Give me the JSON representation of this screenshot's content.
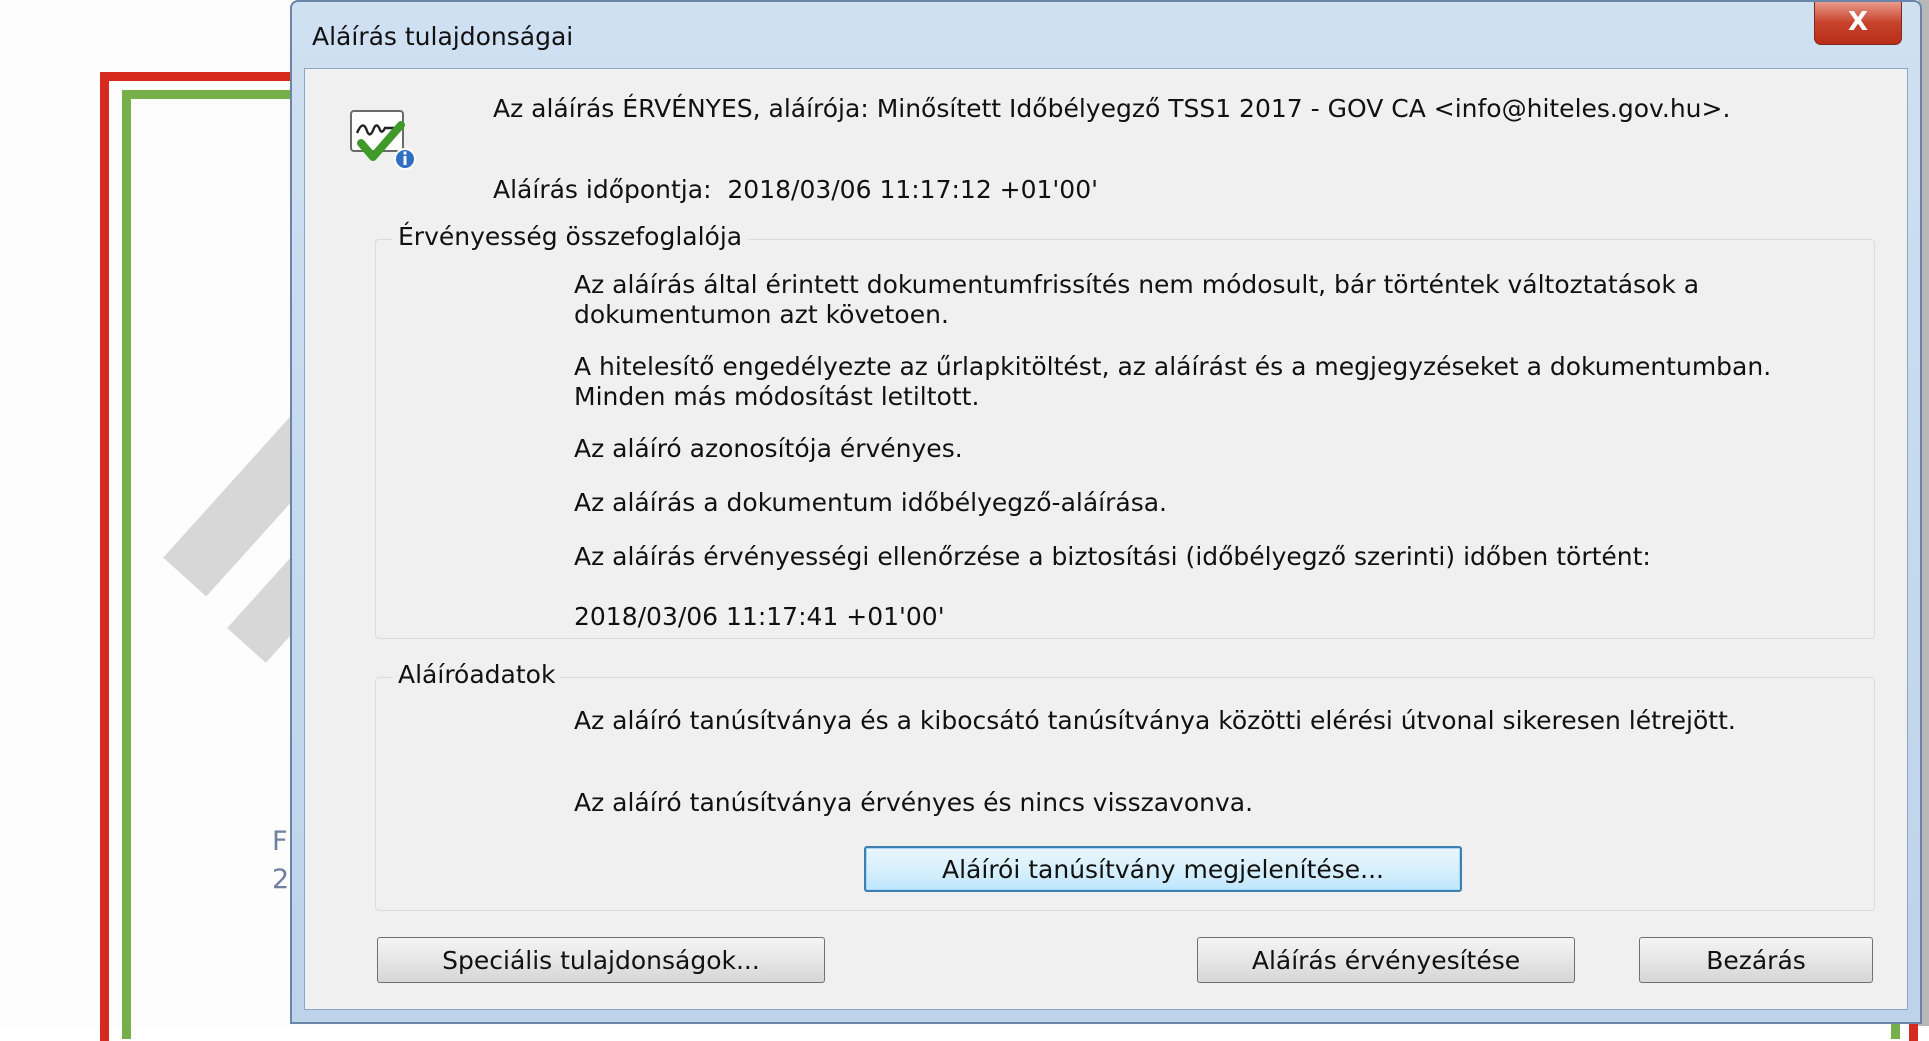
{
  "background": {
    "fragment_1": "F",
    "fragment_2": "2"
  },
  "dialog": {
    "title": "Aláírás tulajdonságai",
    "close_label": "X",
    "status_line": "Az aláírás ÉRVÉNYES, aláírója: Minősített Időbélyegző TSS1 2017 - GOV CA <info@hiteles.gov.hu>.",
    "signing_time_label": "Aláírás időpontja:",
    "signing_time_value": "2018/03/06 11:17:12 +01'00'",
    "validity_summary": {
      "legend": "Érvényesség összefoglalója",
      "lines": [
        "Az aláírás által érintett dokumentumfrissítés nem módosult, bár történtek változtatások a dokumentumon azt követoen.",
        "A hitelesítő engedélyezte az űrlapkitöltést, az aláírást és a megjegyzéseket a dokumentumban. Minden más módosítást letiltott.",
        "Az aláíró azonosítója érvényes.",
        "Az aláírás a dokumentum időbélyegző-aláírása.",
        "Az aláírás érvényességi ellenőrzése a biztosítási (időbélyegző szerinti) időben történt:"
      ],
      "check_time": "2018/03/06 11:17:41 +01'00'"
    },
    "signer_info": {
      "legend": "Aláíróadatok",
      "lines": [
        "Az aláíró tanúsítványa és a kibocsátó tanúsítványa közötti elérési útvonal sikeresen létrejött.",
        "Az aláíró tanúsítványa érvényes és nincs visszavonva."
      ],
      "show_cert_button": "Aláírói tanúsítvány megjelenítése..."
    },
    "buttons": {
      "advanced": "Speciális tulajdonságok...",
      "validate": "Aláírás érvényesítése",
      "close": "Bezárás"
    }
  },
  "colors": {
    "titlebar": "#c4d8ee",
    "close_button": "#c7422c",
    "dialog_body": "#f0f0f0",
    "focused_button_border": "#3c7fb1",
    "doc_border_red": "#d62a1e",
    "doc_border_green": "#77b04a"
  },
  "icons": {
    "signature_status": "signature-valid-icon",
    "close": "close-icon"
  }
}
